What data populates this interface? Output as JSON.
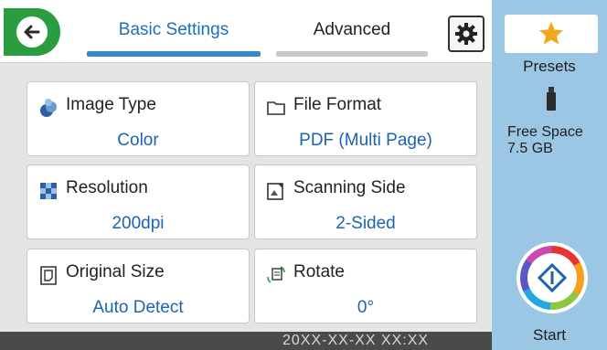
{
  "header": {
    "back_icon": "back-arrow-icon",
    "tabs": [
      {
        "label": "Basic Settings",
        "active": true
      },
      {
        "label": "Advanced",
        "active": false
      }
    ],
    "settings_icon": "gear-icon"
  },
  "settings": [
    {
      "title": "Image Type",
      "value": "Color",
      "icon": "image-type-icon"
    },
    {
      "title": "File Format",
      "value": "PDF (Multi Page)",
      "icon": "folder-icon"
    },
    {
      "title": "Resolution",
      "value": "200dpi",
      "icon": "resolution-icon"
    },
    {
      "title": "Scanning Side",
      "value": "2-Sided",
      "icon": "scanning-side-icon"
    },
    {
      "title": "Original Size",
      "value": "Auto Detect",
      "icon": "original-size-icon"
    },
    {
      "title": "Rotate",
      "value": "0°",
      "icon": "rotate-icon"
    }
  ],
  "footer": {
    "datetime": "20XX-XX-XX XX:XX"
  },
  "sidebar": {
    "presets_label": "Presets",
    "presets_icon": "star-icon",
    "storage_icon": "usb-drive-icon",
    "free_space_label": "Free Space",
    "free_space_value": "7.5 GB",
    "start_label": "Start",
    "start_icon": "start-diamond-icon"
  },
  "colors": {
    "accent_blue": "#1c64b0",
    "back_green": "#2a9d3f",
    "side_panel": "#9cc7e4",
    "star": "#f0a81e"
  }
}
